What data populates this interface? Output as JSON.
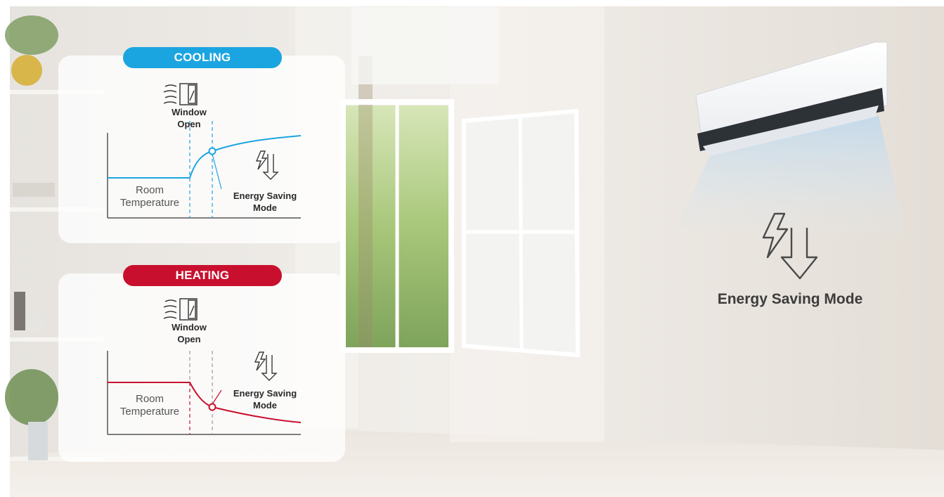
{
  "panels": {
    "cooling": {
      "badge": "COOLING",
      "window_label": "Window\nOpen",
      "room_label": "Room\nTemperature",
      "mode_label": "Energy Saving\nMode",
      "color": "#1ba5e0"
    },
    "heating": {
      "badge": "HEATING",
      "window_label": "Window\nOpen",
      "room_label": "Room\nTemperature",
      "mode_label": "Energy Saving\nMode",
      "color": "#c8102e"
    }
  },
  "hero": {
    "mode_label": "Energy Saving Mode",
    "icon": "energy-saving-icon"
  },
  "icons": {
    "window": "window-open-icon",
    "energy": "energy-saving-icon"
  },
  "colors": {
    "wall": "#ece7e1",
    "text": "#3c3c3c"
  }
}
